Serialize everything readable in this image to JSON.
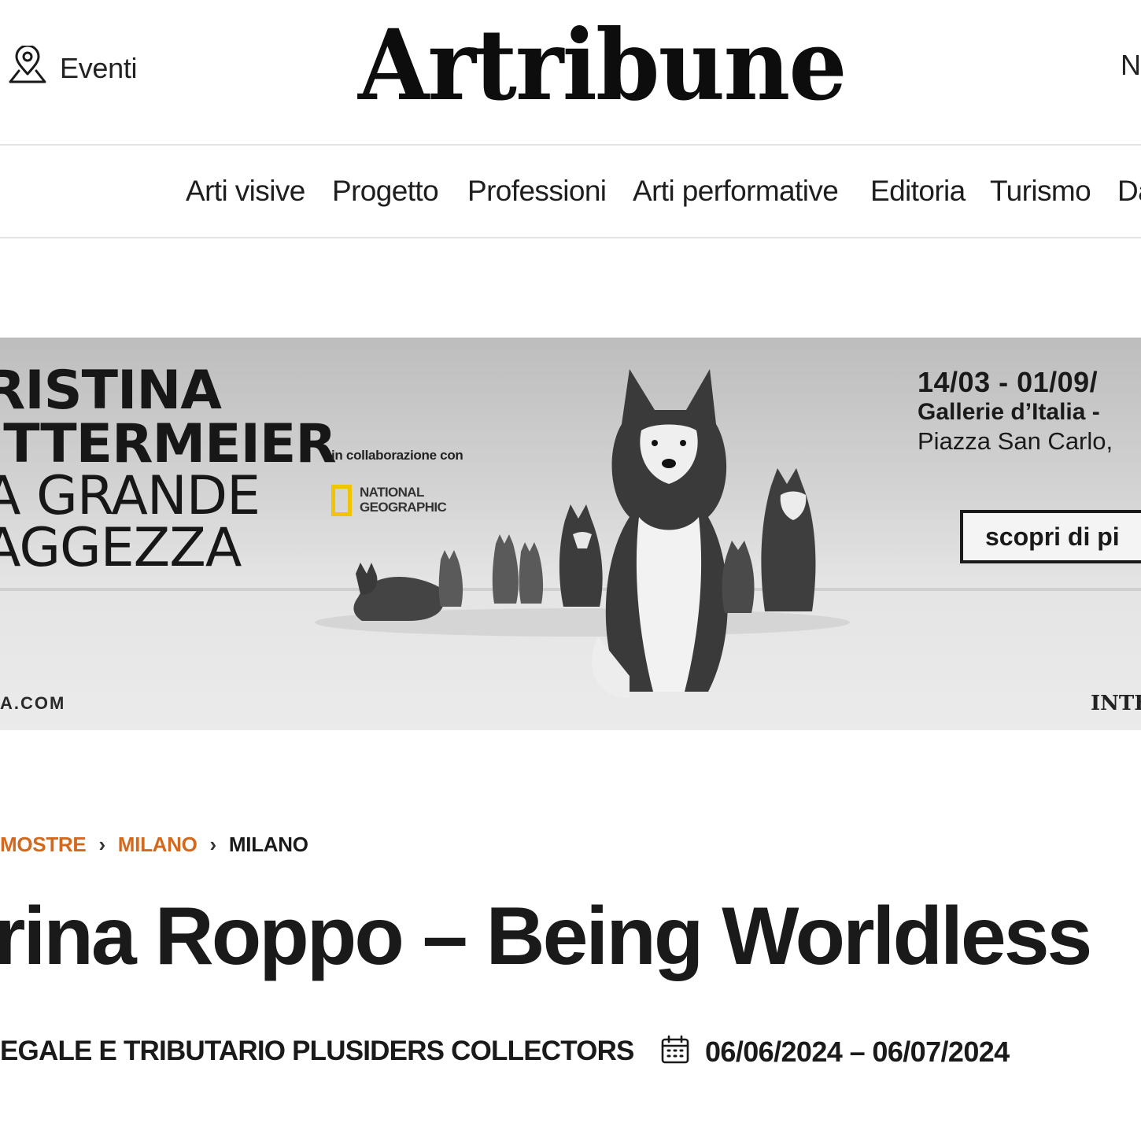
{
  "header": {
    "events_label": "Eventi",
    "logo_text": "Artribune",
    "right_cut_label": "N"
  },
  "nav": {
    "items": [
      "Arti visive",
      "Progetto",
      "Professioni",
      "Arti performative",
      "Editoria",
      "Turismo",
      "Da"
    ]
  },
  "banner": {
    "title_lines": [
      "RISTINA",
      "ITTERMEIER",
      "A GRANDE",
      "AGGEZZA"
    ],
    "collab_label": "in collaborazione con",
    "partner_line1": "NATIONAL",
    "partner_line2": "GEOGRAPHIC",
    "dates": "14/03 - 01/09/",
    "venue": "Gallerie d’Italia -",
    "address": "Piazza San Carlo,",
    "cta_label": "scopri di pi",
    "url_text": "A.COM",
    "sponsor_text": "INTE"
  },
  "breadcrumb": {
    "items": [
      "MOSTRE",
      "MILANO"
    ],
    "separator": "›",
    "current": "MILANO"
  },
  "article": {
    "title": "rina Roppo – Being Worldless",
    "organizer": "EGALE E TRIBUTARIO PLUSIDERS COLLECTORS",
    "date_range": "06/06/2024 – 06/07/2024"
  },
  "colors": {
    "accent": "#d2691e",
    "text": "#1a1a1a",
    "divider": "#e3e3e3",
    "national_geographic_yellow": "#f1c400"
  },
  "icons": {
    "events": "map-pin-icon",
    "date": "calendar-icon"
  }
}
